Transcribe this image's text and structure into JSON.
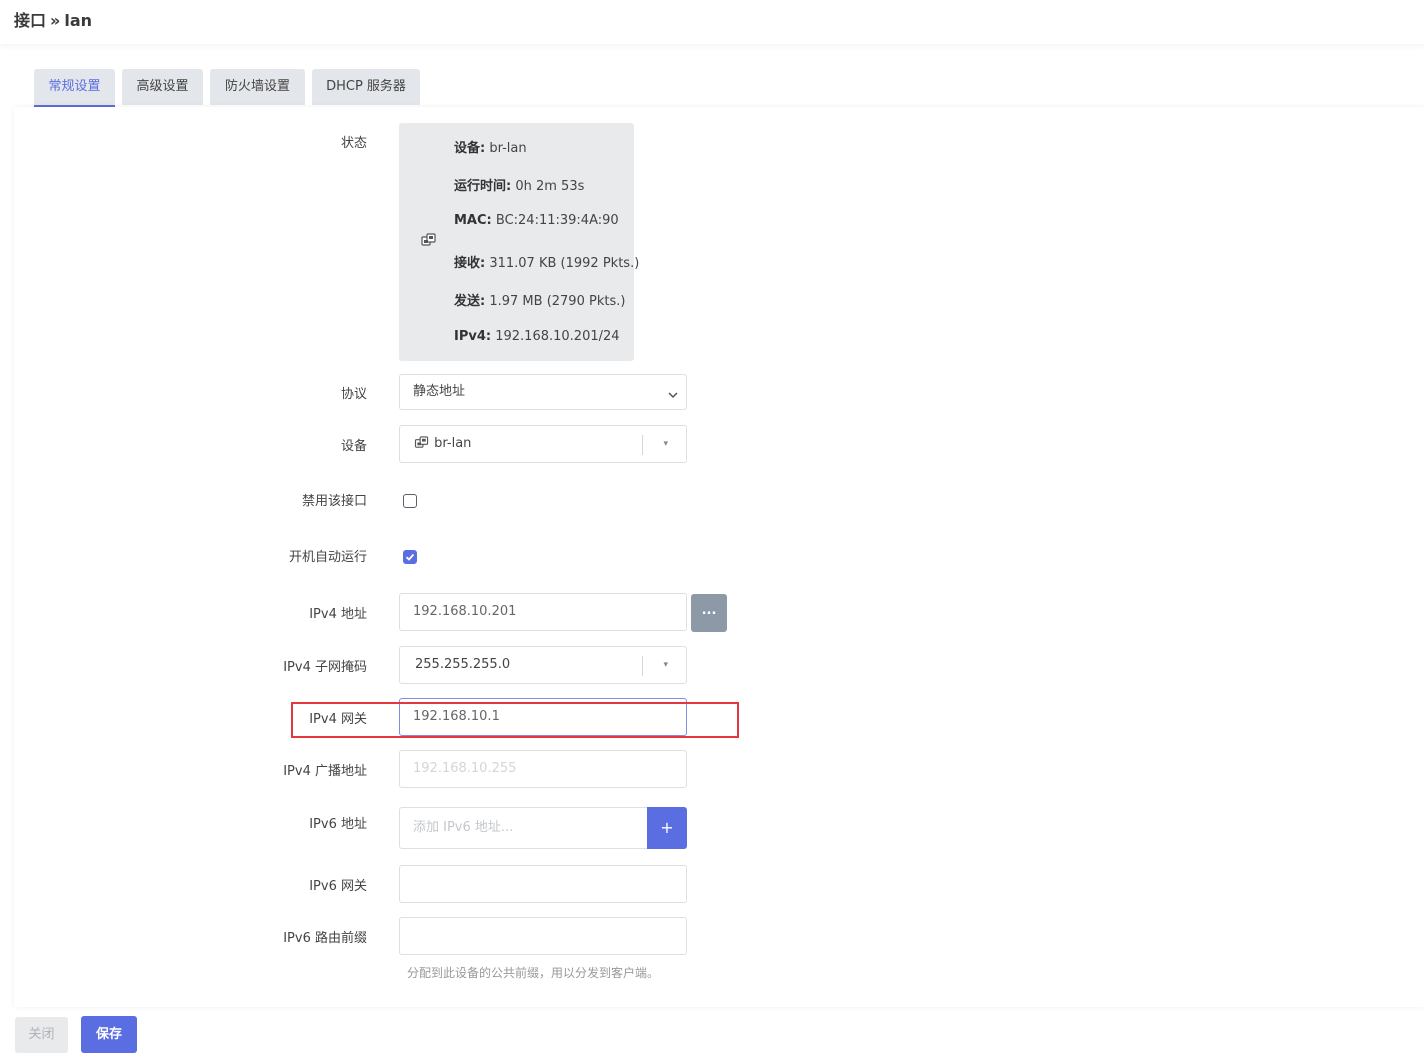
{
  "breadcrumb": {
    "section": "接口",
    "separator": "»",
    "current": "lan"
  },
  "tabs": [
    {
      "label": "常规设置",
      "active": true
    },
    {
      "label": "高级设置",
      "active": false
    },
    {
      "label": "防火墙设置",
      "active": false
    },
    {
      "label": "DHCP 服务器",
      "active": false
    }
  ],
  "status": {
    "label": "状态",
    "icon": "network-adapter-icon",
    "lines": [
      {
        "key": "设备:",
        "value": "br-lan"
      },
      {
        "key": "运行时间:",
        "value": "0h 2m 53s"
      },
      {
        "key": "MAC:",
        "value": "BC:24:11:39:4A:90"
      },
      {
        "key": "接收:",
        "value": "311.07 KB (1992 Pkts.)"
      },
      {
        "key": "发送:",
        "value": "1.97 MB (2790 Pkts.)"
      },
      {
        "key": "IPv4:",
        "value": "192.168.10.201/24"
      }
    ]
  },
  "form": {
    "protocol": {
      "label": "协议",
      "value": "静态地址"
    },
    "device": {
      "label": "设备",
      "value": "br-lan",
      "caret": "▾"
    },
    "disable": {
      "label": "禁用该接口",
      "checked": false
    },
    "autostart": {
      "label": "开机自动运行",
      "checked": true
    },
    "ipv4_address": {
      "label": "IPv4 地址",
      "value": "192.168.10.201",
      "button": "..."
    },
    "ipv4_netmask": {
      "label": "IPv4 子网掩码",
      "value": "255.255.255.0",
      "caret": "▾"
    },
    "ipv4_gateway": {
      "label": "IPv4 网关",
      "value": "192.168.10.1"
    },
    "ipv4_broadcast": {
      "label": "IPv4 广播地址",
      "placeholder": "192.168.10.255"
    },
    "ipv6_address": {
      "label": "IPv6 地址",
      "placeholder": "添加 IPv6 地址...",
      "button": "+"
    },
    "ipv6_gateway": {
      "label": "IPv6 网关",
      "value": ""
    },
    "ipv6_prefix": {
      "label": "IPv6 路由前缀",
      "value": "",
      "hint": "分配到此设备的公共前缀，用以分发到客户端。"
    }
  },
  "actions": {
    "close": "关闭",
    "save": "保存"
  },
  "colors": {
    "accent": "#5b6ee1",
    "highlight": "#e3383d",
    "secondary_button": "#8e99a8"
  }
}
